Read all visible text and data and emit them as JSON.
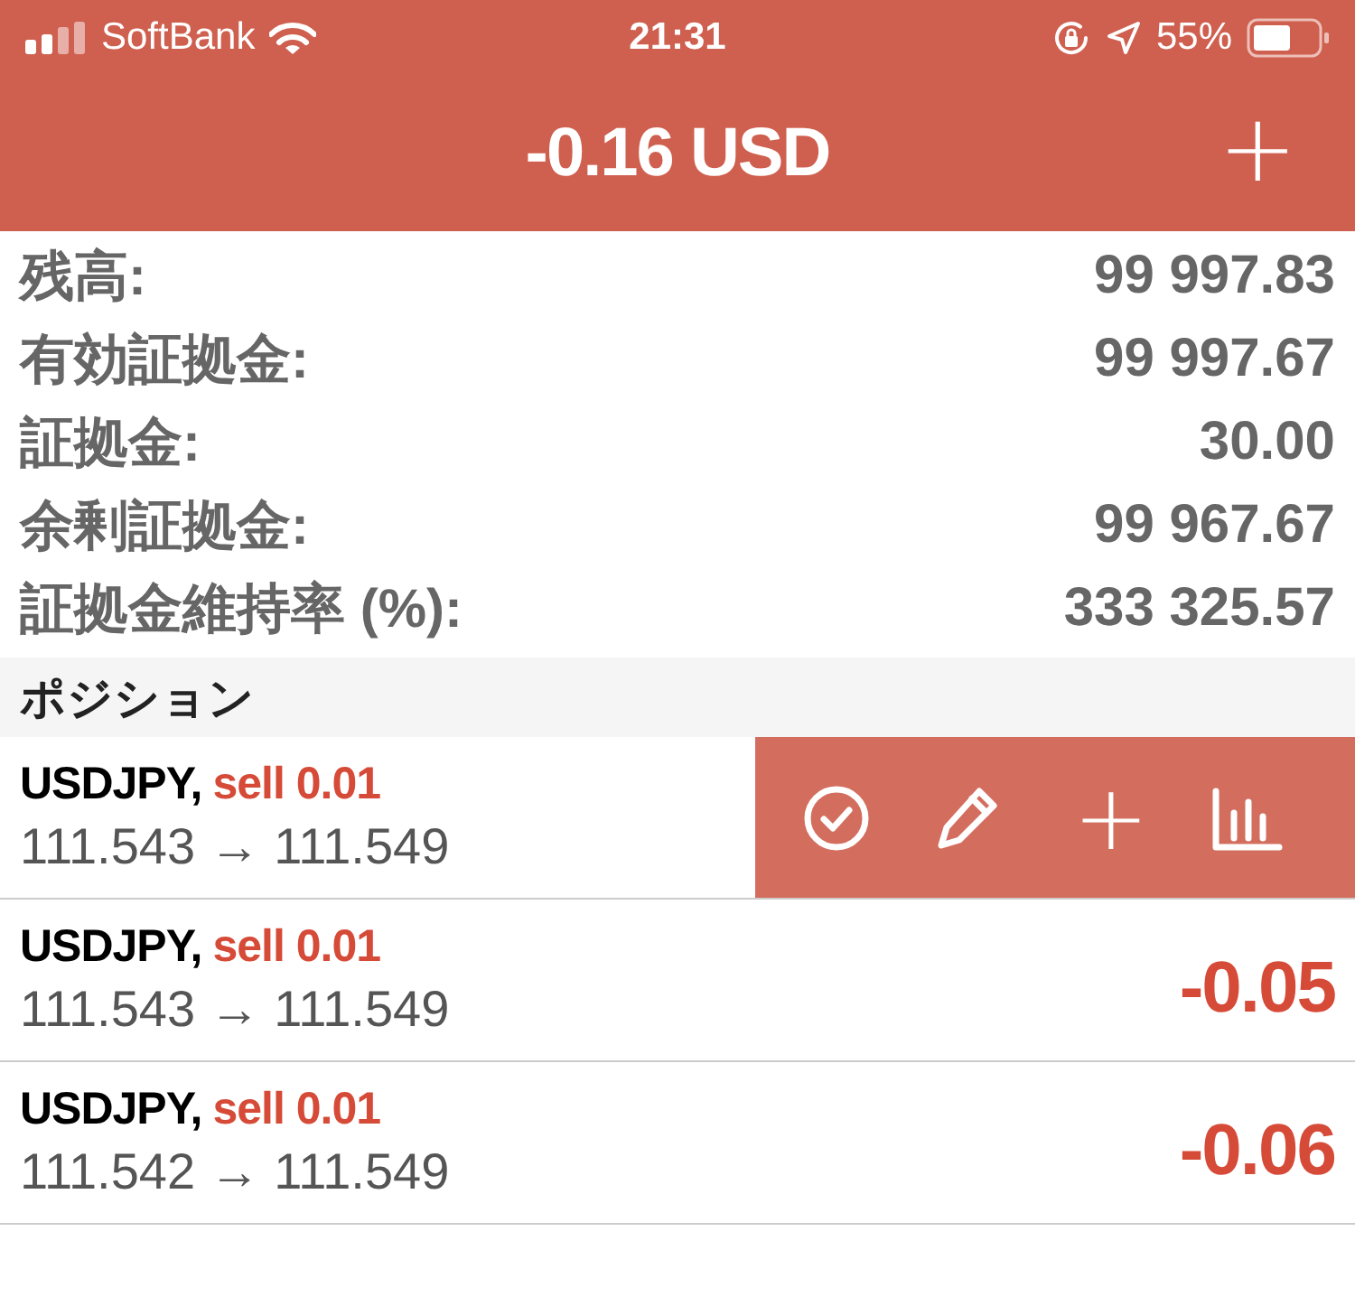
{
  "status_bar": {
    "carrier": "SoftBank",
    "time": "21:31",
    "battery": "55%"
  },
  "header": {
    "title": "-0.16 USD",
    "add": "+"
  },
  "summary": [
    {
      "label": "残高:",
      "value": "99 997.83"
    },
    {
      "label": "有効証拠金:",
      "value": "99 997.67"
    },
    {
      "label": "証拠金:",
      "value": "30.00"
    },
    {
      "label": "余剰証拠金:",
      "value": "99 967.67"
    },
    {
      "label": "証拠金維持率 (%):",
      "value": "333 325.57"
    }
  ],
  "section_title": "ポジション",
  "positions": [
    {
      "symbol": "USDJPY,",
      "side": "sell 0.01",
      "prices": "111.543 → 111.549",
      "actions_open": true
    },
    {
      "symbol": "USDJPY,",
      "side": "sell 0.01",
      "prices": "111.543 → 111.549",
      "profit": "-0.05",
      "actions_open": false
    },
    {
      "symbol": "USDJPY,",
      "side": "sell 0.01",
      "prices": "111.542 → 111.549",
      "profit": "-0.06",
      "actions_open": false
    }
  ],
  "row_actions": {
    "add": "+"
  }
}
